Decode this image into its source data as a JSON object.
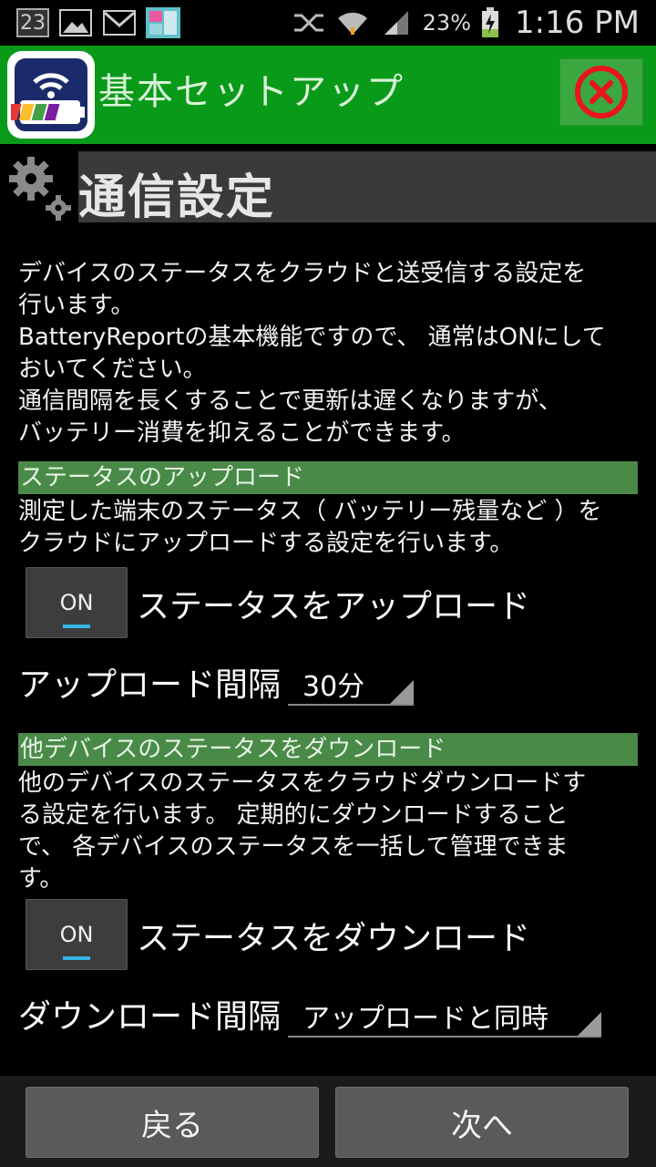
{
  "status_bar": {
    "notification_number": "23",
    "battery_percent": "23%",
    "time": "1:16 PM"
  },
  "app_bar": {
    "title": "基本セットアップ"
  },
  "section": {
    "title": "通信設定",
    "description": [
      "デバイスのステータスをクラウドと送受信する設定を",
      "行います。",
      "BatteryReportの基本機能ですので、 通常はONにして",
      "おいてください。",
      "通信間隔を長くすることで更新は遅くなりますが、",
      "バッテリー消費を抑えることができます。"
    ]
  },
  "upload": {
    "heading": "ステータスのアップロード",
    "description": [
      "測定した端末のステータス（ バッテリー残量など ）を",
      "クラウドにアップロードする設定を行います。"
    ],
    "toggle_state": "ON",
    "toggle_label": "ステータスをアップロード",
    "interval_label": "アップロード間隔",
    "interval_value": "30分"
  },
  "download": {
    "heading": "他デバイスのステータスをダウンロード",
    "description": [
      "他のデバイスのステータスをクラウドダウンロードす",
      "る設定を行います。 定期的にダウンロードすること",
      "で、 各デバイスのステータスを一括して管理できま",
      "す。"
    ],
    "toggle_state": "ON",
    "toggle_label": "ステータスをダウンロード",
    "interval_label": "ダウンロード間隔",
    "interval_value": "アップロードと同時"
  },
  "footer": {
    "back_label": "戻る",
    "next_label": "次へ"
  },
  "colors": {
    "app_bar": "#0a9a1a",
    "section_bar": "#4a8a48",
    "toggle_indicator": "#33b5e5",
    "close_icon": "#e8141e"
  },
  "icons": [
    "gallery-icon",
    "gmail-icon",
    "app-thumbnail-icon",
    "nfc-icon",
    "wifi-icon",
    "signal-icon",
    "battery-charging-icon",
    "gear-icon",
    "close-icon",
    "battery-report-app-icon"
  ]
}
